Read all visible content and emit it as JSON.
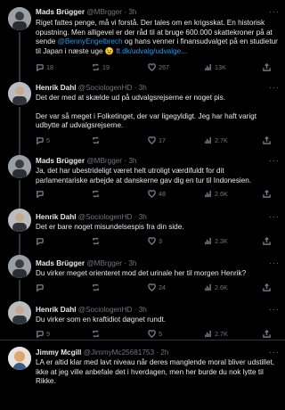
{
  "tweets": [
    {
      "name": "Mads Brügger",
      "handle": "@MBrgger",
      "time": "3h",
      "text_a": "Riget fattes penge, må vi forstå. Der tales om en krigsskat. En historisk opustning. Men alligevel er der råd til at bruge 600.000 skattekroner på at sende ",
      "mention": "@BennyEngelbrech",
      "text_b": " og hans venner i finansudvalget på en studietur til Japan i næste uge 😉 ",
      "link": "ft.dk/udvalg/udvalge...",
      "replies": "18",
      "reposts": "19",
      "likes": "267",
      "views": "13K"
    },
    {
      "name": "Henrik Dahl",
      "handle": "@SociologenHD",
      "time": "3h",
      "p1": "Det der med at skælde ud på udvalgsrejserne er noget pis.",
      "p2": "Der var så meget i Folketinget, der var ligegyldigt. Jeg har haft varigt udbytte af udvalgsrejserne.",
      "replies": "5",
      "reposts": "",
      "likes": "17",
      "views": "2.7K"
    },
    {
      "name": "Mads Brügger",
      "handle": "@MBrgger",
      "time": "3h",
      "text": "Ja, det har ubestrideligt været helt utroligt værdifuldt for dit parlamentariske arbejde at danskerne gav dig en tur til Indonesien.",
      "replies": "",
      "reposts": "",
      "likes": "48",
      "views": "2.6K"
    },
    {
      "name": "Henrik Dahl",
      "handle": "@SociologenHD",
      "time": "3h",
      "text": "Det er bare noget misundelsespis fra din side.",
      "replies": "",
      "reposts": "",
      "likes": "3",
      "views": "2.3K"
    },
    {
      "name": "Mads Brügger",
      "handle": "@MBrgger",
      "time": "3h",
      "text": "Du virker meget orienteret mod det urinale her til morgen Henrik?",
      "replies": "",
      "reposts": "",
      "likes": "24",
      "views": "2.6K"
    },
    {
      "name": "Henrik Dahl",
      "handle": "@SociologenHD",
      "time": "3h",
      "text": "Du virker som en kraftidiot døgnet rundt.",
      "replies": "9",
      "reposts": "",
      "likes": "5",
      "views": "2.7K"
    },
    {
      "name": "Jimmy Mcgill",
      "handle": "@JimmyMc25681753",
      "time": "2h",
      "text": "LA er altid klar med lavt niveau når deres manglende moral bliver udstillet, ikke at jeg ville anbefale det i hverdagen, men her burde du nok lytte til Rikke.",
      "replies": "",
      "reposts": "",
      "likes": "",
      "views": ""
    }
  ],
  "separator_dot": "·",
  "more_icon": "···",
  "colors": {
    "background": "#000000",
    "text": "#e7e9ea",
    "muted": "#71767b",
    "link": "#1d9bf0"
  }
}
